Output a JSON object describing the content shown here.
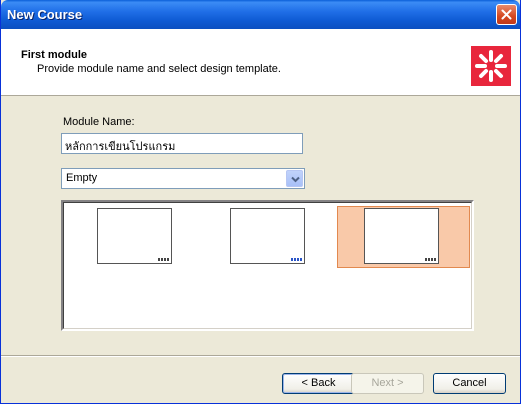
{
  "window": {
    "title": "New Course"
  },
  "header": {
    "title": "First module",
    "subtitle": "Provide module name and select design template."
  },
  "form": {
    "module_name_label": "Module Name:",
    "module_name_value": "หลักการเขียนโปรแกรม",
    "template_select_value": "Empty"
  },
  "templates": [
    {
      "name": "template-blank-1",
      "selected": false
    },
    {
      "name": "template-blank-2",
      "selected": false
    },
    {
      "name": "template-blank-3",
      "selected": true
    }
  ],
  "buttons": {
    "back_label": "< Back",
    "next_label": "Next >",
    "cancel_label": "Cancel"
  },
  "colors": {
    "titlebar": "#0f5bd4",
    "logo": "#e8263c",
    "selection": "#f9c9a9"
  },
  "icons": [
    "close-icon",
    "app-logo-icon",
    "chevron-down-icon"
  ]
}
